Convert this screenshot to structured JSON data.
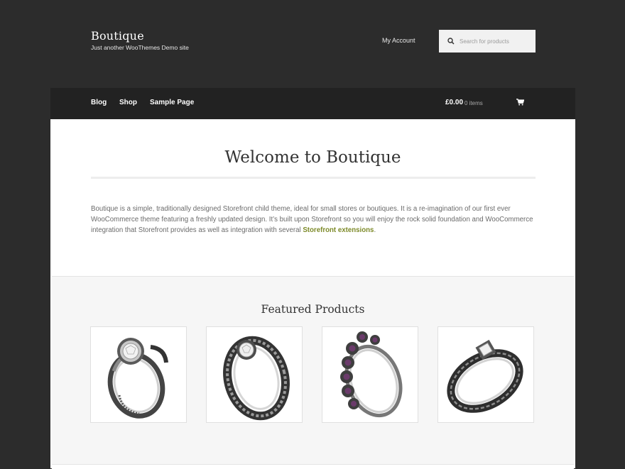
{
  "site": {
    "title": "Boutique",
    "description": "Just another WooThemes Demo site"
  },
  "header": {
    "my_account": "My Account",
    "search_placeholder": "Search for products"
  },
  "nav": {
    "items": [
      "Blog",
      "Shop",
      "Sample Page"
    ],
    "cart_total": "£0.00",
    "cart_count": "0 items"
  },
  "page": {
    "title": "Welcome to Boutique",
    "intro_text": "Boutique is a simple, traditionally designed Storefront child theme, ideal for small stores or boutiques. It is a re-imagination of our first ever WooCommerce theme featuring a freshly updated design. It’s built upon Storefront so you will enjoy the rock solid foundation and WooCommerce integration that Storefront provides as well as integration with several ",
    "intro_link": "Storefront extensions",
    "intro_end": "."
  },
  "featured": {
    "title": "Featured Products",
    "products": [
      {
        "icon": "ring-diamond-halo-image"
      },
      {
        "icon": "ring-engraved-filigree-image"
      },
      {
        "icon": "ring-gemstone-cluster-image"
      },
      {
        "icon": "ring-inscribed-band-image"
      }
    ]
  },
  "colors": {
    "background": "#2c2c2c",
    "navbar": "#222222",
    "accent_link": "#7d8a29",
    "featured_bg": "#f6f6f6"
  }
}
